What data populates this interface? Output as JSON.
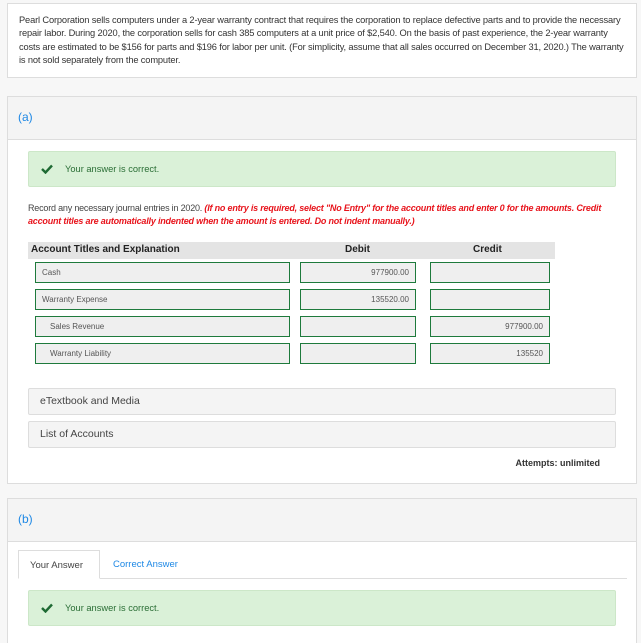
{
  "problem": {
    "text": "Pearl Corporation sells computers under a 2-year warranty contract that requires the corporation to replace defective parts and to provide the necessary repair labor. During 2020, the corporation sells for cash 385 computers at a unit price of $2,540. On the basis of past experience, the 2-year warranty costs are estimated to be $156 for parts and $196 for labor per unit. (For simplicity, assume that all sales occurred on December 31, 2020.) The warranty is not sold separately from the computer."
  },
  "part_a": {
    "label": "(a)",
    "alert": "Your answer is correct.",
    "instruction": "Record any necessary journal entries in 2020.",
    "instruction_note": "(If no entry is required, select \"No Entry\" for the account titles and enter 0 for the amounts. Credit account titles are automatically indented when the amount is entered. Do not indent manually.)",
    "table": {
      "headers": {
        "account": "Account Titles and Explanation",
        "debit": "Debit",
        "credit": "Credit"
      },
      "rows": [
        {
          "account": "Cash",
          "debit": "977900.00",
          "credit": ""
        },
        {
          "account": "Warranty Expense",
          "debit": "135520.00",
          "credit": ""
        },
        {
          "account": "Sales Revenue",
          "debit": "",
          "credit": "977900.00"
        },
        {
          "account": "Warranty Liability",
          "debit": "",
          "credit": "135520"
        }
      ]
    },
    "etextbook": "eTextbook and Media",
    "list_of_accounts": "List of Accounts",
    "attempts": "Attempts: unlimited"
  },
  "part_b": {
    "label": "(b)",
    "tabs": [
      "Your Answer",
      "Correct Answer"
    ],
    "alert": "Your answer is correct."
  },
  "colors": {
    "accent": "#1e88e5",
    "success_bg": "#daf1d8",
    "success_text": "#2a6e35",
    "field_border": "#1e7a3c",
    "note_red": "#e8141c"
  }
}
